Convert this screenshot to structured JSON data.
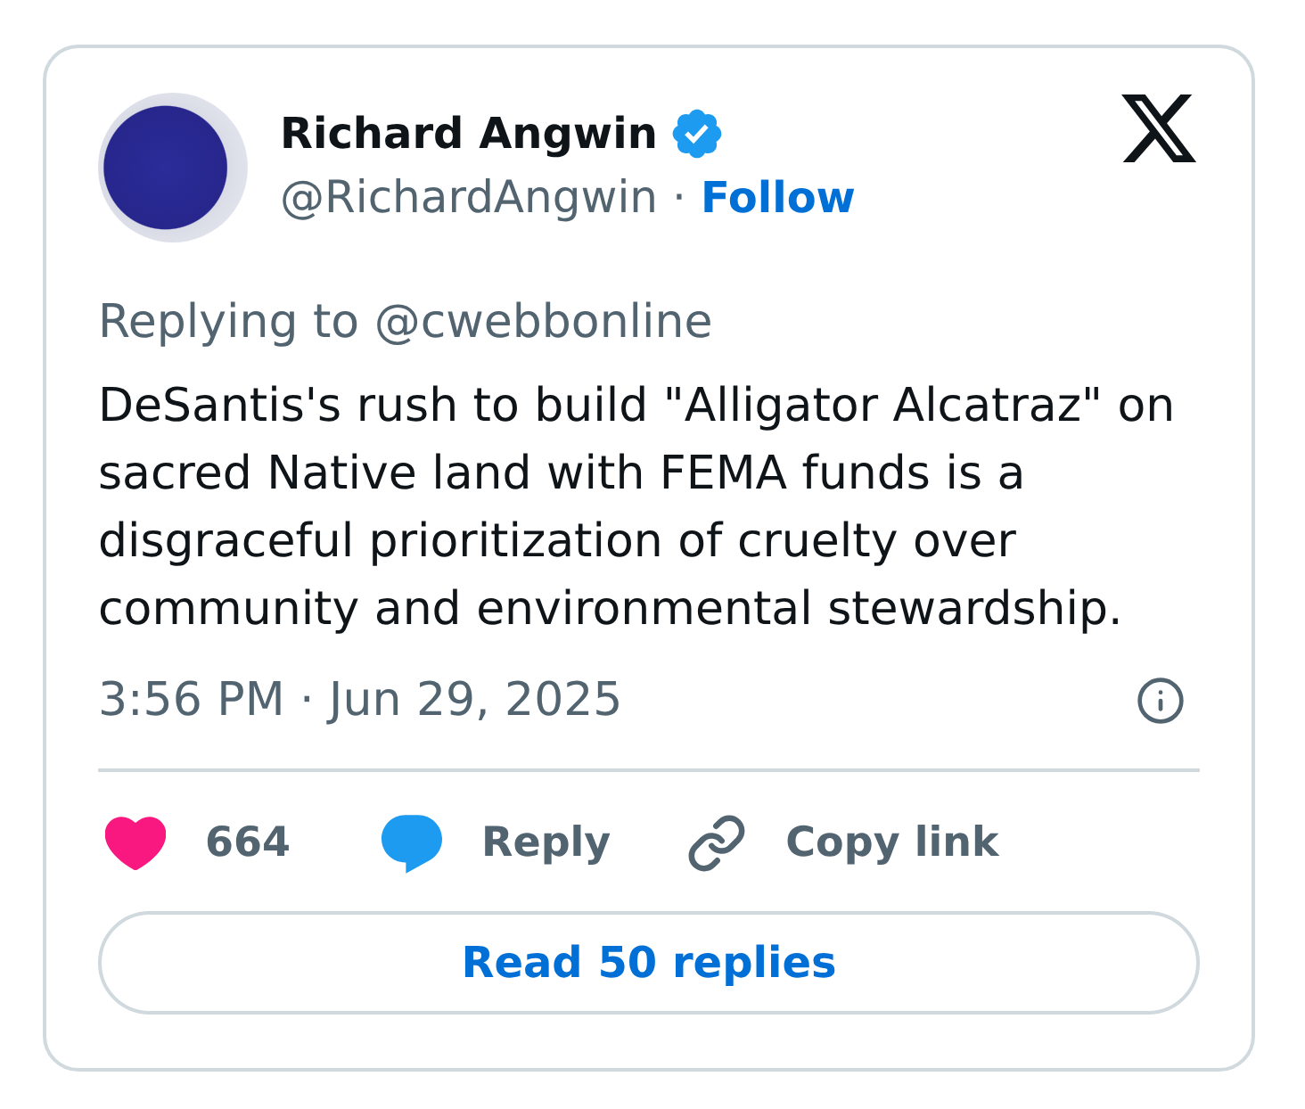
{
  "author": {
    "name": "Richard Angwin",
    "verified": true,
    "handle": "@RichardAngwin",
    "separator": "·",
    "follow": "Follow"
  },
  "reply_to": "Replying to @cwebbonline",
  "body": "DeSantis's rush to build \"Alligator Alcatraz\" on sacred Native land with FEMA funds is a disgraceful prioritization of cruelty over community and environmental stewardship.",
  "timestamp": "3:56 PM · Jun 29, 2025",
  "actions": [
    {
      "kind": "like",
      "label": "664"
    },
    {
      "kind": "reply",
      "label": "Reply"
    },
    {
      "kind": "copy",
      "label": "Copy link"
    }
  ],
  "read_replies": "Read 50 replies"
}
